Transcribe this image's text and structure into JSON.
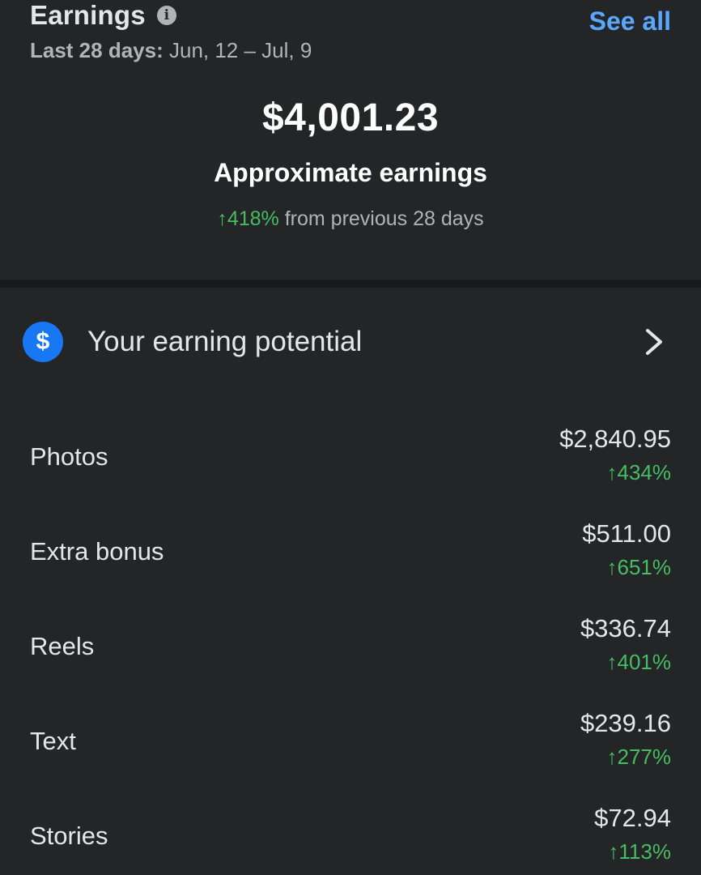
{
  "header": {
    "title": "Earnings",
    "see_all": "See all",
    "date_label": "Last 28 days:",
    "date_range": "Jun, 12 – Jul, 9",
    "info_icon": "info-icon"
  },
  "summary": {
    "total": "$4,001.23",
    "label": "Approximate earnings",
    "change_percent": "↑418%",
    "change_text": "from previous 28 days"
  },
  "potential": {
    "icon": "dollar-icon",
    "label": "Your earning potential",
    "chevron": "chevron-right-icon"
  },
  "breakdown": [
    {
      "label": "Photos",
      "amount": "$2,840.95",
      "change": "↑434%"
    },
    {
      "label": "Extra bonus",
      "amount": "$511.00",
      "change": "↑651%"
    },
    {
      "label": "Reels",
      "amount": "$336.74",
      "change": "↑401%"
    },
    {
      "label": "Text",
      "amount": "$239.16",
      "change": "↑277%"
    },
    {
      "label": "Stories",
      "amount": "$72.94",
      "change": "↑113%"
    }
  ],
  "colors": {
    "background": "#242526",
    "accent_link": "#5aa7ff",
    "positive": "#45bd62",
    "icon_blue": "#1877f2"
  }
}
